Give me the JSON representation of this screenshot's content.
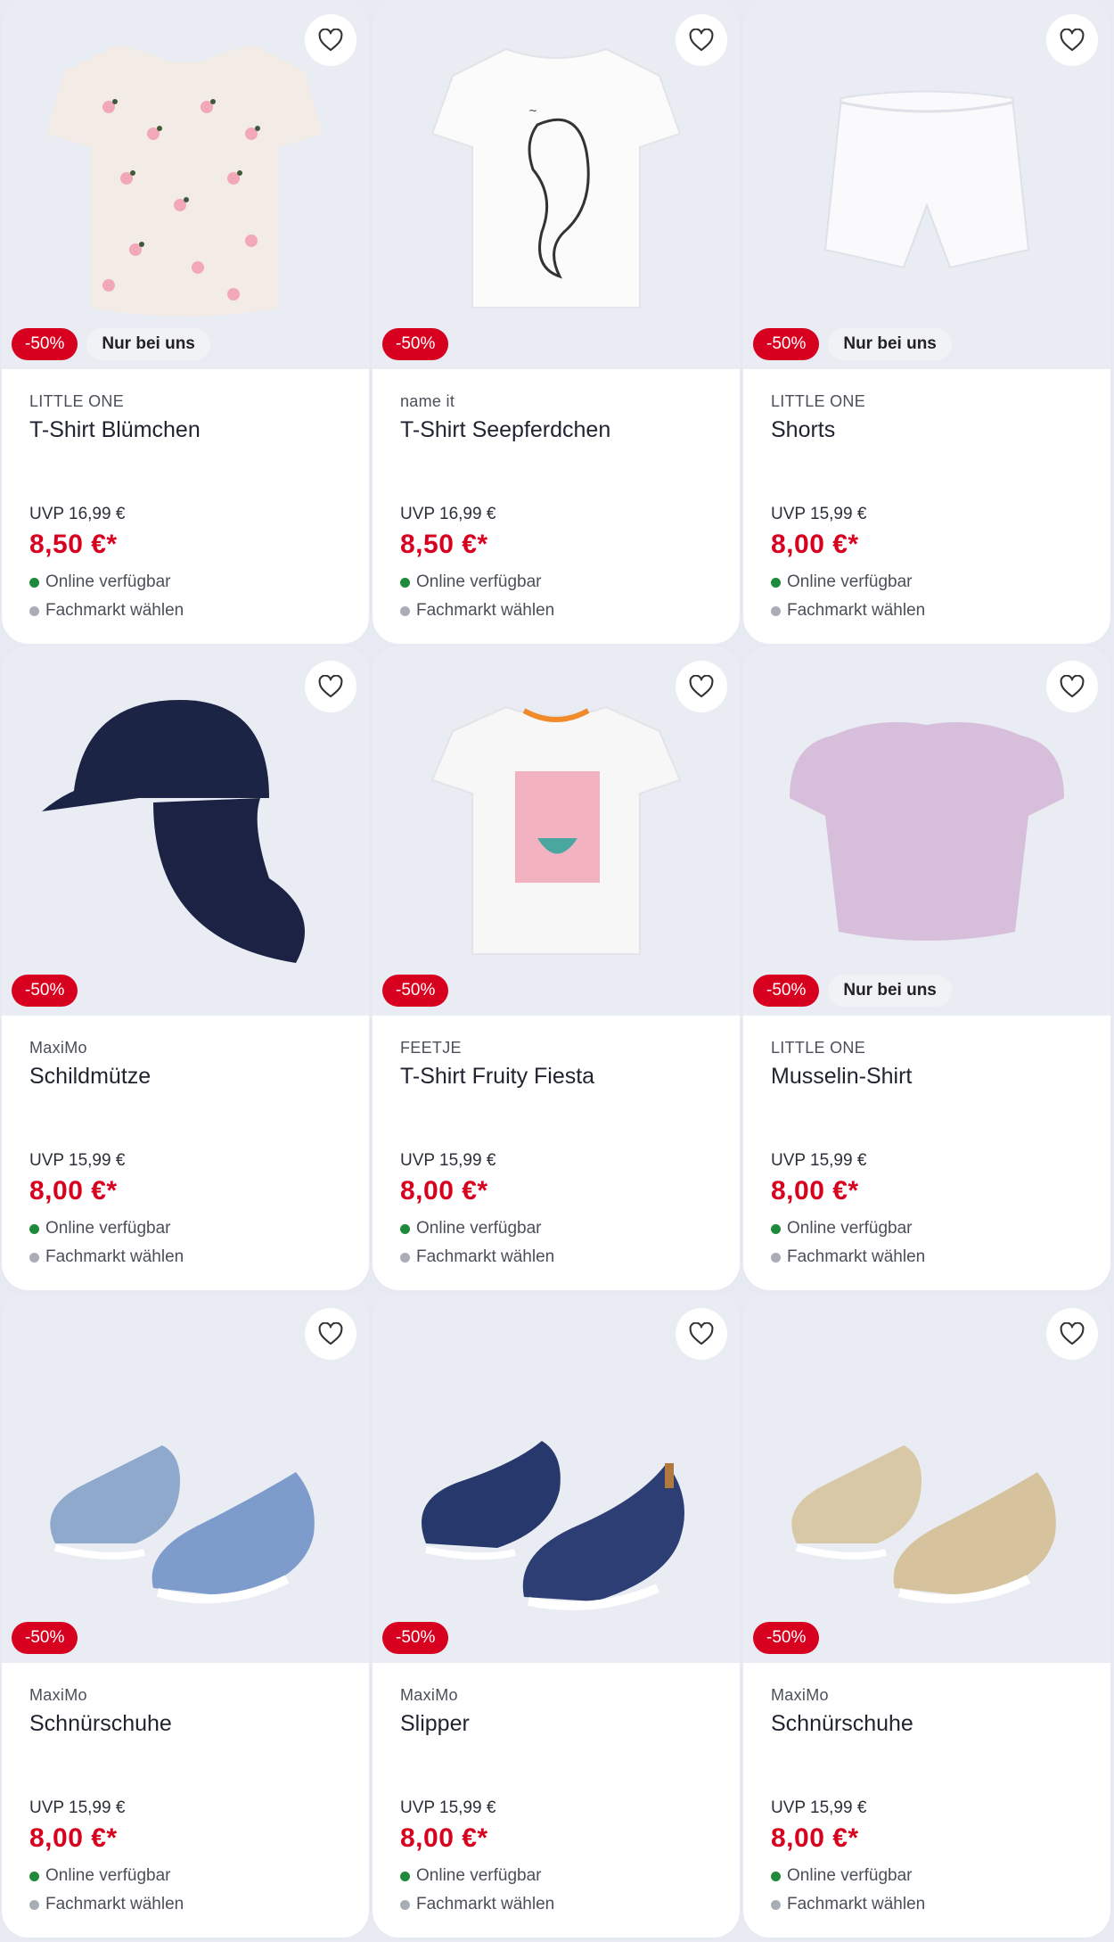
{
  "colors": {
    "sale": "#d8001f",
    "online": "#1f8a3b",
    "market": "#a9adb6",
    "text": "#1f2330"
  },
  "products": [
    {
      "brand": "LITTLE ONE",
      "name": "T-Shirt Blümchen",
      "uvp": "UVP 16,99 €",
      "price": "8,50 €*",
      "sale": "-50%",
      "exclusive": "Nur bei uns",
      "online": "Online verfügbar",
      "market": "Fachmarkt wählen",
      "image": "floral-shirt"
    },
    {
      "brand": "name it",
      "name": "T-Shirt Seepferdchen",
      "uvp": "UVP 16,99 €",
      "price": "8,50 €*",
      "sale": "-50%",
      "exclusive": "",
      "online": "Online verfügbar",
      "market": "Fachmarkt wählen",
      "image": "seahorse-shirt"
    },
    {
      "brand": "LITTLE ONE",
      "name": "Shorts",
      "uvp": "UVP 15,99 €",
      "price": "8,00 €*",
      "sale": "-50%",
      "exclusive": "Nur bei uns",
      "online": "Online verfügbar",
      "market": "Fachmarkt wählen",
      "image": "white-shorts"
    },
    {
      "brand": "MaxiMo",
      "name": "Schildmütze",
      "uvp": "UVP 15,99 €",
      "price": "8,00 €*",
      "sale": "-50%",
      "exclusive": "",
      "online": "Online verfügbar",
      "market": "Fachmarkt wählen",
      "image": "navy-cap"
    },
    {
      "brand": "FEETJE",
      "name": "T-Shirt Fruity Fiesta",
      "uvp": "UVP 15,99 €",
      "price": "8,00 €*",
      "sale": "-50%",
      "exclusive": "",
      "online": "Online verfügbar",
      "market": "Fachmarkt wählen",
      "image": "fruity-shirt"
    },
    {
      "brand": "LITTLE ONE",
      "name": "Musselin-Shirt",
      "uvp": "UVP 15,99 €",
      "price": "8,00 €*",
      "sale": "-50%",
      "exclusive": "Nur bei uns",
      "online": "Online verfügbar",
      "market": "Fachmarkt wählen",
      "image": "lilac-shirt"
    },
    {
      "brand": "MaxiMo",
      "name": "Schnürschuhe",
      "uvp": "UVP 15,99 €",
      "price": "8,00 €*",
      "sale": "-50%",
      "exclusive": "",
      "online": "Online verfügbar",
      "market": "Fachmarkt wählen",
      "image": "blue-lace-shoes"
    },
    {
      "brand": "MaxiMo",
      "name": "Slipper",
      "uvp": "UVP 15,99 €",
      "price": "8,00 €*",
      "sale": "-50%",
      "exclusive": "",
      "online": "Online verfügbar",
      "market": "Fachmarkt wählen",
      "image": "navy-slippers"
    },
    {
      "brand": "MaxiMo",
      "name": "Schnürschuhe",
      "uvp": "UVP 15,99 €",
      "price": "8,00 €*",
      "sale": "-50%",
      "exclusive": "",
      "online": "Online verfügbar",
      "market": "Fachmarkt wählen",
      "image": "beige-lace-shoes"
    }
  ]
}
